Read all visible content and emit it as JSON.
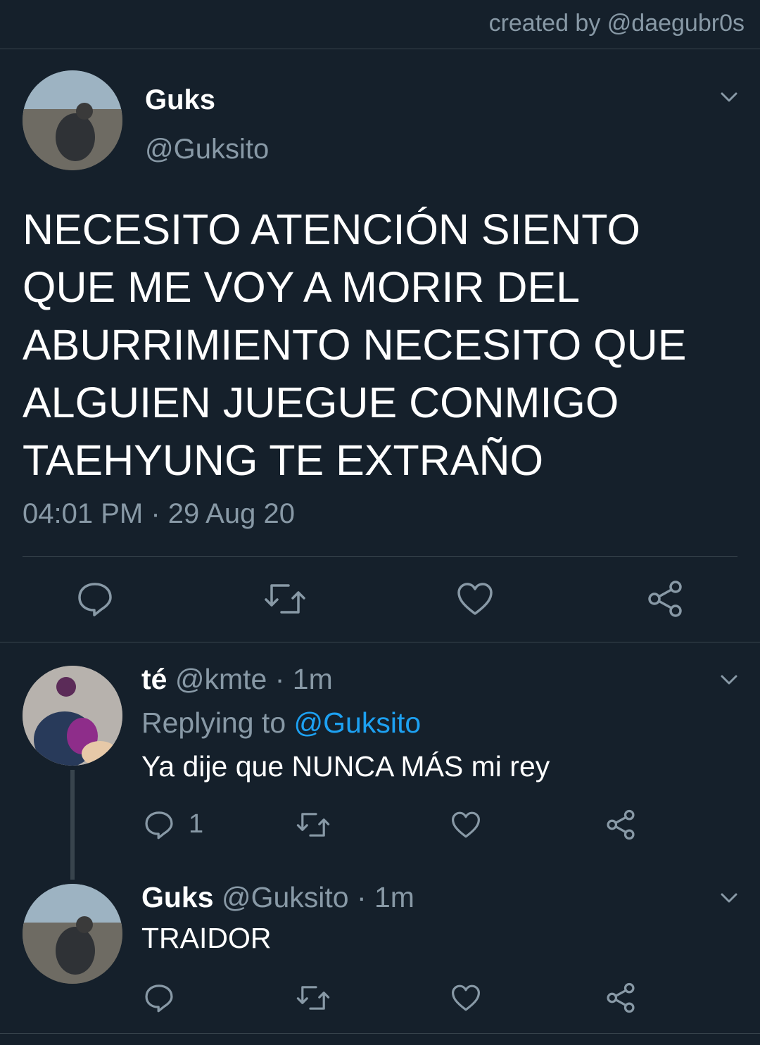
{
  "header": {
    "credit": "created by @daegubr0s"
  },
  "tweet": {
    "name": "Guks",
    "handle": "@Guksito",
    "lines": [
      "NECESITO ATENCIÓN SIENTO",
      "QUE ME VOY A MORIR DEL",
      "ABURRIMIENTO NECESITO QUE",
      "ALGUIEN JUEGUE CONMIGO",
      "TAEHYUNG TE EXTRAÑO"
    ],
    "timestamp": "04:01 PM · 29 Aug 20",
    "avatar_icon": "avatar-photo"
  },
  "reply1": {
    "name": "té",
    "meta": "@kmte · 1m",
    "replying_label": "Replying to",
    "replying_handle": "@Guksito",
    "text": "Ya dije que NUNCA MÁS mi rey",
    "reply_count": "1"
  },
  "reply2": {
    "name": "Guks",
    "meta": "@Guksito · 1m",
    "text": "TRAIDOR"
  },
  "icons": {
    "reply": "reply-icon",
    "retweet": "retweet-icon",
    "like": "like-icon",
    "share": "share-icon",
    "more": "chevron-down-icon"
  },
  "colors": {
    "background": "#15202b",
    "muted": "#8899a6",
    "link": "#1da1f2",
    "divider": "#38444d"
  }
}
